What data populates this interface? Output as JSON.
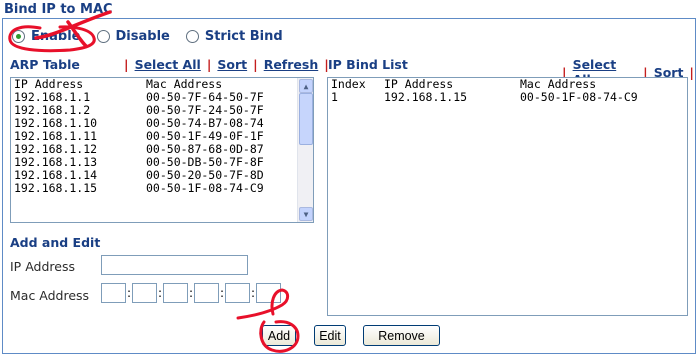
{
  "title": "Bind IP to MAC",
  "modes": [
    {
      "label": "Enable",
      "selected": true
    },
    {
      "label": "Disable",
      "selected": false
    },
    {
      "label": "Strict Bind",
      "selected": false
    }
  ],
  "arp_table": {
    "label": "ARP Table",
    "links": [
      "Select All",
      "Sort",
      "Refresh"
    ],
    "columns": [
      "IP Address",
      "Mac Address"
    ],
    "rows": [
      [
        "192.168.1.1",
        "00-50-7F-64-50-7F"
      ],
      [
        "192.168.1.2",
        "00-50-7F-24-50-7F"
      ],
      [
        "192.168.1.10",
        "00-50-74-B7-08-74"
      ],
      [
        "192.168.1.11",
        "00-50-1F-49-0F-1F"
      ],
      [
        "192.168.1.12",
        "00-50-87-68-0D-87"
      ],
      [
        "192.168.1.13",
        "00-50-DB-50-7F-8F"
      ],
      [
        "192.168.1.14",
        "00-50-20-50-7F-8D"
      ],
      [
        "192.168.1.15",
        "00-50-1F-08-74-C9"
      ]
    ]
  },
  "ip_bind_list": {
    "label": "IP Bind List",
    "links": [
      "Select All",
      "Sort"
    ],
    "columns": [
      "Index",
      "IP Address",
      "Mac Address"
    ],
    "rows": [
      [
        "1",
        "192.168.1.15",
        "00-50-1F-08-74-C9"
      ]
    ]
  },
  "add_edit": {
    "label": "Add and Edit",
    "ip_label": "IP Address",
    "mac_label": "Mac Address",
    "ip_value": "",
    "mac_separator": ":"
  },
  "buttons": {
    "add": "Add",
    "edit": "Edit",
    "remove": "Remove"
  },
  "colors": {
    "heading": "#1a3f84",
    "link_separator": "#c41e1e",
    "border": "#5e8bc6",
    "annotation": "#e8102a"
  }
}
